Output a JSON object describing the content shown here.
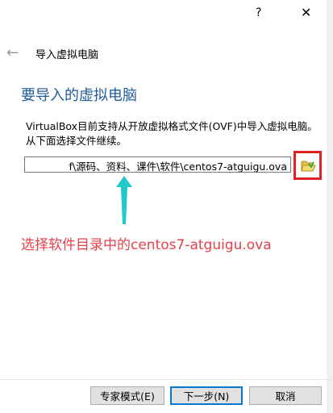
{
  "window": {
    "help_glyph": "?",
    "close_glyph": "✕"
  },
  "header": {
    "back_glyph": "←",
    "title": "导入虚拟电脑"
  },
  "main": {
    "section_title": "要导入的虚拟电脑",
    "description": "VirtualBox目前支持从开放虚拟格式文件(OVF)中导入虚拟电脑。从下面选择文件继续。",
    "file_path": "f\\源码、资料、课件\\软件\\centos7-atguigu.ova",
    "browse_icon": "folder-open-icon"
  },
  "annotation": {
    "text": "选择软件目录中的centos7-atguigu.ova",
    "text_color": "#e8404a",
    "arrow_color": "#21c8cc",
    "highlight_color": "#e02424"
  },
  "footer": {
    "expert_label": "专家模式(E)",
    "next_label": "下一步(N)",
    "cancel_label": "取消"
  },
  "colors": {
    "title_blue": "#1f5c9a",
    "default_button_border": "#0078d7"
  }
}
